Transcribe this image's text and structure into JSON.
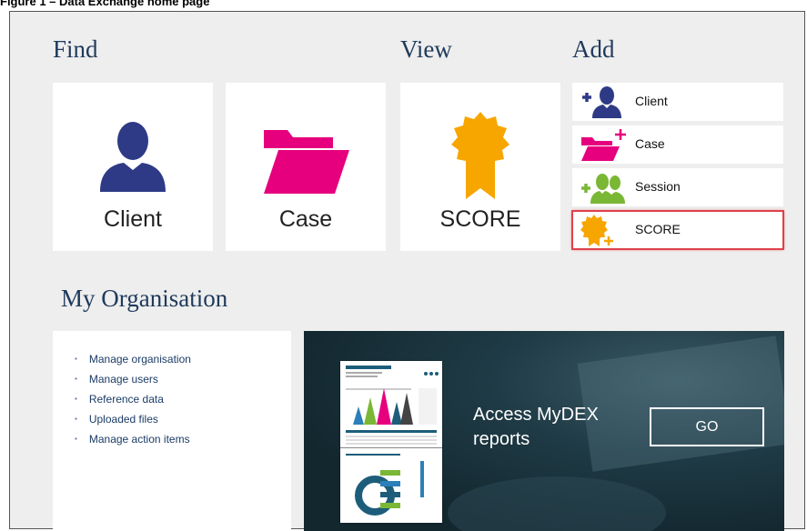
{
  "caption": "Figure 1 – Data Exchange home page",
  "headings": {
    "find": "Find",
    "view": "View",
    "add": "Add",
    "my_org": "My Organisation"
  },
  "find_tiles": [
    {
      "label": "Client",
      "icon": "person-icon",
      "color": "#2e3a86"
    },
    {
      "label": "Case",
      "icon": "folder-icon",
      "color": "#e6007e"
    }
  ],
  "view_tiles": [
    {
      "label": "SCORE",
      "icon": "rosette-icon",
      "color": "#f7a600"
    }
  ],
  "add_items": [
    {
      "label": "Client",
      "icon": "add-person-icon",
      "color": "#2e3a86"
    },
    {
      "label": "Case",
      "icon": "add-folder-icon",
      "color": "#e6007e"
    },
    {
      "label": "Session",
      "icon": "add-group-icon",
      "color": "#7ab735"
    },
    {
      "label": "SCORE",
      "icon": "add-rosette-icon",
      "color": "#f7a600",
      "selected": true
    }
  ],
  "my_org_links": [
    "Manage organisation",
    "Manage users",
    "Reference data",
    "Uploaded files",
    "Manage action items"
  ],
  "promo": {
    "text_line1": "Access MyDEX",
    "text_line2": "reports",
    "button": "GO"
  }
}
